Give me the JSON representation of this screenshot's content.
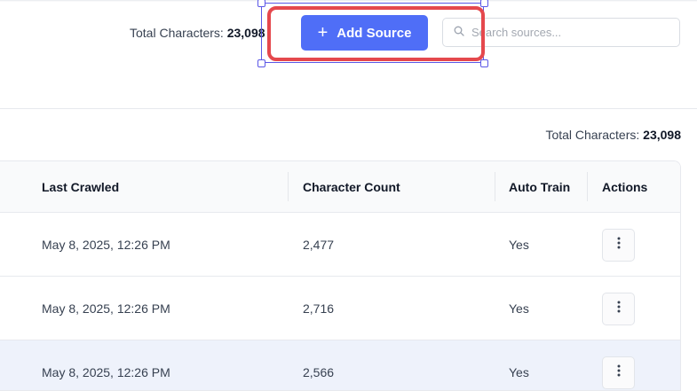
{
  "header": {
    "total_label": "Total Characters:",
    "total_value": "23,098",
    "add_source_label": "Add Source",
    "search_placeholder": "Search sources..."
  },
  "summary": {
    "total_label": "Total Characters:",
    "total_value": "23,098"
  },
  "table": {
    "columns": [
      "Last Crawled",
      "Character Count",
      "Auto Train",
      "Actions"
    ],
    "rows": [
      {
        "last_crawled": "May 8, 2025, 12:26 PM",
        "character_count": "2,477",
        "auto_train": "Yes"
      },
      {
        "last_crawled": "May 8, 2025, 12:26 PM",
        "character_count": "2,716",
        "auto_train": "Yes"
      },
      {
        "last_crawled": "May 8, 2025, 12:26 PM",
        "character_count": "2,566",
        "auto_train": "Yes"
      }
    ]
  },
  "colors": {
    "accent": "#4f6ef7",
    "highlight_border": "#e5484d",
    "selection": "#5b57e6",
    "row_highlight": "#eef2fb"
  },
  "icons": {
    "add": "plus-icon",
    "search": "search-icon",
    "actions": "more-vertical-icon"
  }
}
